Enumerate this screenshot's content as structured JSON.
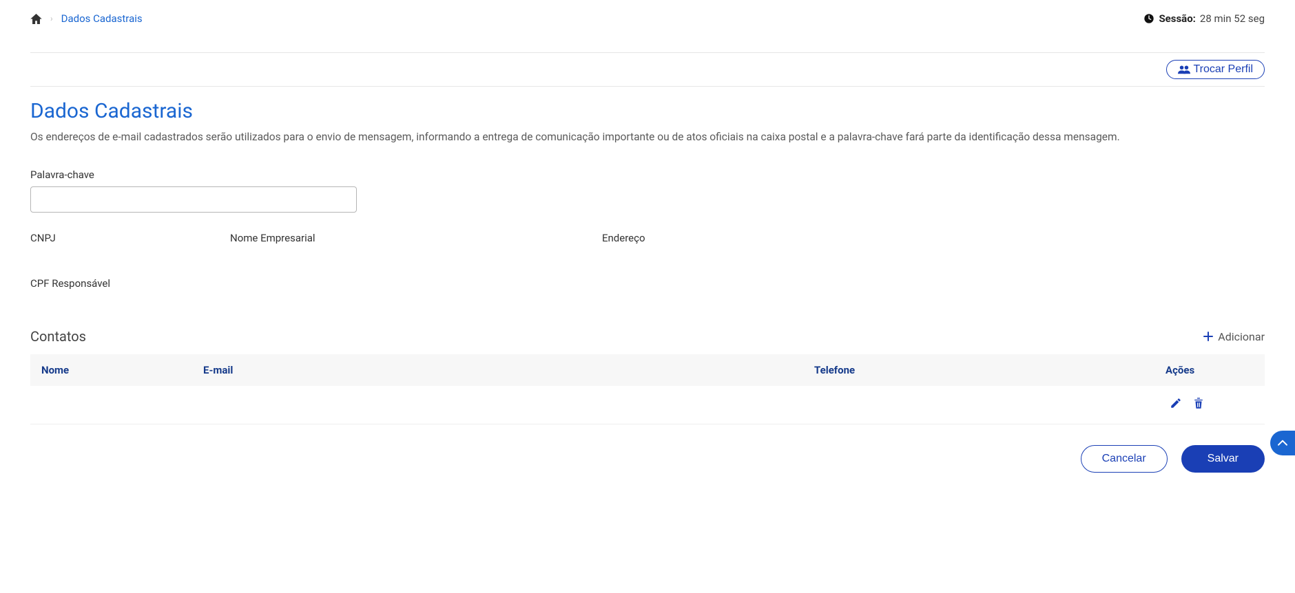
{
  "breadcrumb": {
    "home_icon": "home",
    "current": "Dados Cadastrais"
  },
  "session": {
    "label": "Sessão:",
    "time": "28 min 52 seg"
  },
  "toolbar": {
    "switch_profile": "Trocar Perfil"
  },
  "page": {
    "title": "Dados Cadastrais",
    "description": "Os endereços de e-mail cadastrados serão utilizados para o envio de mensagem, informando a entrega de comunicação importante ou de atos oficiais na caixa postal e a palavra-chave fará parte da identificação dessa mensagem."
  },
  "fields": {
    "keyword_label": "Palavra-chave",
    "keyword_value": "",
    "cnpj_label": "CNPJ",
    "nome_emp_label": "Nome Empresarial",
    "endereco_label": "Endereço",
    "cpf_resp_label": "CPF Responsável"
  },
  "contacts": {
    "title": "Contatos",
    "add_label": "Adicionar",
    "columns": {
      "nome": "Nome",
      "email": "E-mail",
      "telefone": "Telefone",
      "acoes": "Ações"
    },
    "rows": [
      {
        "nome": "",
        "email": "",
        "telefone": ""
      }
    ]
  },
  "actions": {
    "cancel": "Cancelar",
    "save": "Salvar"
  }
}
